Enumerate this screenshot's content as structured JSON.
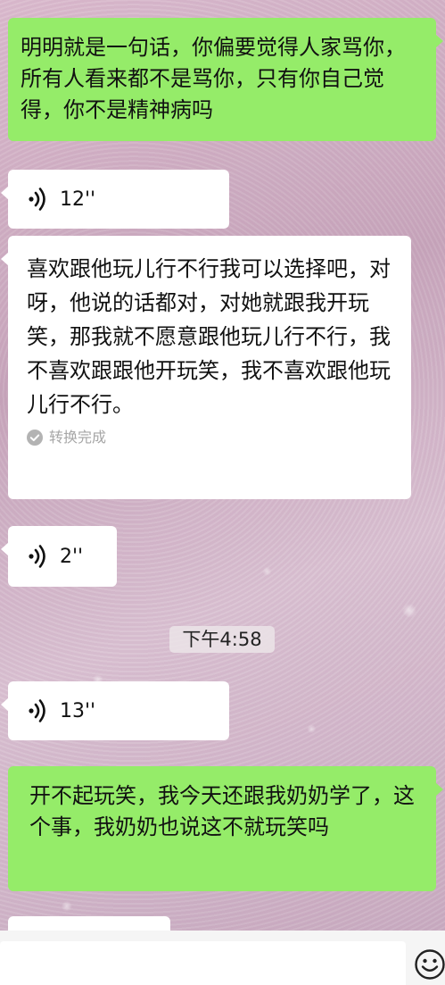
{
  "messages": [
    {
      "side": "right",
      "type": "text",
      "text": "明明就是一句话，你偏要觉得人家骂你，所有人看来都不是骂你，只有你自己觉得，你不是精神病吗"
    },
    {
      "side": "left",
      "type": "voice",
      "duration": "12''"
    },
    {
      "side": "left",
      "type": "text",
      "text": "喜欢跟他玩儿行不行我可以选择吧，对呀，他说的话都对，对她就跟我开玩笑，那我就不愿意跟他玩儿行不行，我不喜欢跟跟他开玩笑，我不喜欢跟他玩儿行不行。",
      "status": "转换完成"
    },
    {
      "side": "left",
      "type": "voice",
      "duration": "2''"
    },
    {
      "side": "left",
      "type": "voice",
      "duration": "13''"
    },
    {
      "side": "right",
      "type": "text",
      "text": "开不起玩笑，我今天还跟我奶奶学了，这个事，我奶奶也说这不就玩笑吗"
    }
  ],
  "timestamp": "下午4:58",
  "icons": {
    "voice": "voice-wave-icon",
    "check": "check-circle-icon",
    "emoji": "emoji-smile-icon"
  },
  "colors": {
    "sent_bubble": "#95ec69",
    "received_bubble": "#ffffff"
  }
}
